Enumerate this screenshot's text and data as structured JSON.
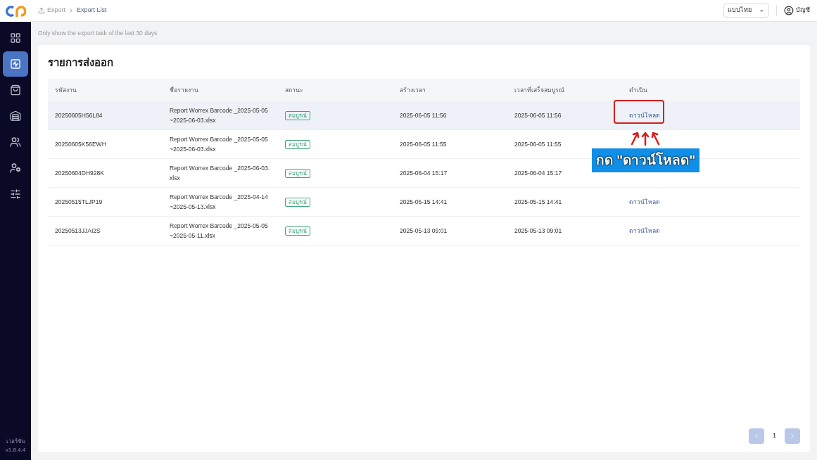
{
  "breadcrumb": [
    {
      "label": "Export",
      "selected": false
    },
    {
      "label": "Export List",
      "selected": true
    }
  ],
  "language_select": {
    "value": "แบบไทย"
  },
  "account": {
    "label": "บัญชี"
  },
  "sidebar": {
    "items": [
      {
        "selected": false
      },
      {
        "selected": true
      },
      {
        "selected": false
      },
      {
        "selected": false
      },
      {
        "selected": false
      },
      {
        "selected": false
      },
      {
        "selected": false
      }
    ],
    "version_label": "เวอร์ชัน",
    "version": "v1.8.4.4"
  },
  "notice": "Only show the export task of the last 30 days",
  "title": "รายการส่งออก",
  "table": {
    "columns": [
      "รหัสงาน",
      "ชื่อรายงาน",
      "สถานะ",
      "สร้างเวลา",
      "เวลาที่เสร็จสมบูรณ์",
      "ดำเนิน"
    ],
    "rows": [
      {
        "id": "20250605H56L84",
        "name": "Report Worrex Barcode _2025-05-05~2025-06-03.xlsx",
        "status": "สมบูรณ์",
        "created": "2025-06-05 11:56",
        "completed": "2025-06-05 11:56",
        "action": "ดาวน์โหลด",
        "selected": true,
        "highlighted": true
      },
      {
        "id": "20250605K56EWH",
        "name": "Report Worrex Barcode _2025-05-05~2025-06-03.xlsx",
        "status": "สมบูรณ์",
        "created": "2025-06-05 11:55",
        "completed": "2025-06-05 11:55",
        "selected": false,
        "highlighted": false
      },
      {
        "id": "20250604DH928K",
        "name": "Report Worrex Barcode _2025-06-03.xlsx",
        "status": "สมบูรณ์",
        "created": "2025-06-04 15:17",
        "completed": "2025-06-04 15:17",
        "selected": false,
        "highlighted": false
      },
      {
        "id": "20250515TLJP19",
        "name": "Report Worrex Barcode _2025-04-14~2025-05-13.xlsx",
        "status": "สมบูรณ์",
        "created": "2025-05-15 14:41",
        "completed": "2025-05-15 14:41",
        "action": "ดาวน์โหลด",
        "selected": false,
        "highlighted": false
      },
      {
        "id": "20250513JJAI2S",
        "name": "Report Worrex Barcode _2025-05-05~2025-05-11.xlsx",
        "status": "สมบูรณ์",
        "created": "2025-05-13 09:01",
        "completed": "2025-05-13 09:01",
        "action": "ดาวน์โหลด",
        "selected": false,
        "highlighted": false
      }
    ]
  },
  "annotation": {
    "text": "กด \"ดาวน์โหลด\""
  },
  "pagination": {
    "pages": [
      {
        "label": "1",
        "selected": true
      }
    ]
  }
}
